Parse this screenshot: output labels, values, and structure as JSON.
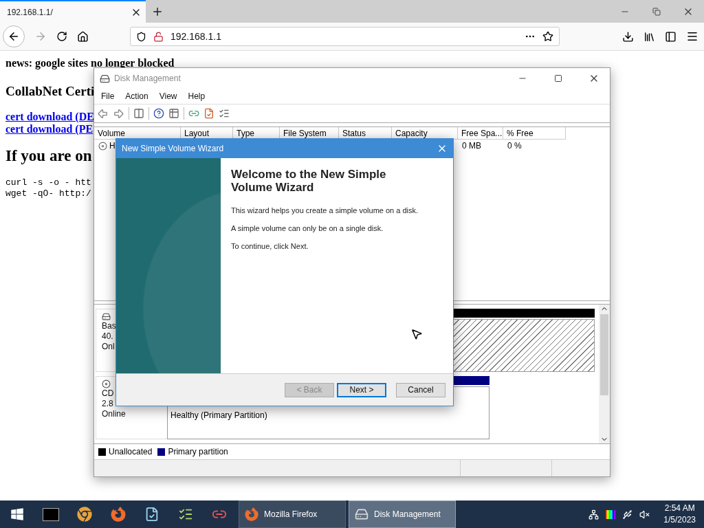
{
  "browser": {
    "tabs": [
      {
        "title": "192.168.1.1/",
        "selected": true
      }
    ],
    "url": "192.168.1.1"
  },
  "page": {
    "news": "news: google sites no longer blocked",
    "heading": "CollabNet Certi",
    "links": [
      "cert download (DE",
      "cert download (PE"
    ],
    "heading2": "If you are on",
    "code_lines": [
      "curl -s -o - htt",
      "wget -qO- http:/"
    ]
  },
  "disk_management": {
    "title": "Disk Management",
    "menu": [
      "File",
      "Action",
      "View",
      "Help"
    ],
    "columns": [
      "Volume",
      "Layout",
      "Type",
      "File System",
      "Status",
      "Capacity",
      "Free Spa...",
      "% Free"
    ],
    "row": {
      "volume": "H",
      "free_space": "0 MB",
      "percent_free": "0 %"
    },
    "disks": [
      {
        "kind": "disk",
        "labels": [
          "Bas",
          "40.",
          "Onl"
        ],
        "partitions": [
          {
            "kind": "unallocated"
          }
        ]
      },
      {
        "kind": "cdrom",
        "labels": [
          "CD",
          "2.8",
          "Online"
        ],
        "partitions": [
          {
            "kind": "primary",
            "status": "Healthy (Primary Partition)"
          }
        ]
      }
    ],
    "legend": [
      {
        "label": "Unallocated",
        "color": "#000000"
      },
      {
        "label": "Primary partition",
        "color": "#000080"
      }
    ]
  },
  "wizard": {
    "title": "New Simple Volume Wizard",
    "heading": "Welcome to the New Simple Volume Wizard",
    "paragraphs": [
      "This wizard helps you create a simple volume on a disk.",
      "A simple volume can only be on a single disk.",
      "To continue, click Next."
    ],
    "buttons": [
      {
        "label": "< Back",
        "disabled": true,
        "focused": false
      },
      {
        "label": "Next >",
        "disabled": false,
        "focused": true
      },
      {
        "label": "Cancel",
        "disabled": false,
        "focused": false
      }
    ]
  },
  "taskbar": {
    "windows": [
      {
        "kind": "firefox",
        "label": "Mozilla Firefox",
        "selected": false
      },
      {
        "kind": "disk",
        "label": "Disk Management",
        "selected": true
      }
    ],
    "time": "2:54 AM",
    "date": "1/5/2023"
  }
}
